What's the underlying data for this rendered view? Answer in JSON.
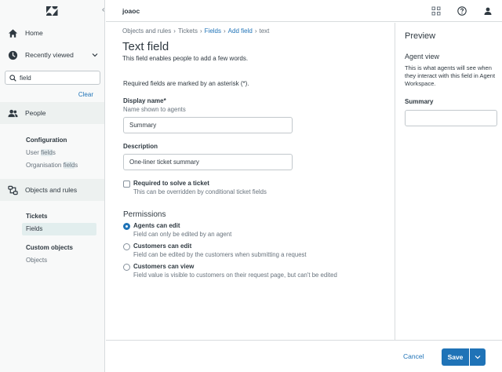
{
  "app": {
    "account": "joaoc"
  },
  "sidebar": {
    "home": "Home",
    "recently_viewed": "Recently viewed",
    "search_value": "field",
    "clear": "Clear",
    "people": "People",
    "configuration": "Configuration",
    "user_fields": {
      "pre": "User ",
      "hl": "field",
      "post": "s"
    },
    "org_fields": {
      "pre": "Organisation ",
      "hl": "field",
      "post": "s"
    },
    "objects_rules": "Objects and rules",
    "tickets": "Tickets",
    "fields": {
      "hl": "Field",
      "post": "s"
    },
    "custom_objects": "Custom objects",
    "objects": "Objects"
  },
  "breadcrumb": {
    "c1": "Objects and rules",
    "c2": "Tickets",
    "c3": "Fields",
    "c4": "Add field",
    "c5": "text",
    "sep": "›"
  },
  "page": {
    "title": "Text field",
    "subtitle": "This field enables people to add a few words.",
    "required_note": "Required fields are marked by an asterisk (*)."
  },
  "form": {
    "display_name_label": "Display name*",
    "display_name_hint": "Name shown to agents",
    "display_name_value": "Summary",
    "description_label": "Description",
    "description_value": "One-liner ticket summary",
    "required_label": "Required to solve a ticket",
    "required_hint": "This can be overridden by conditional ticket fields"
  },
  "permissions": {
    "heading": "Permissions",
    "options": [
      {
        "label": "Agents can edit",
        "hint": "Field can only be edited by an agent"
      },
      {
        "label": "Customers can edit",
        "hint": "Field can be edited by the customers when submitting a request"
      },
      {
        "label": "Customers can view",
        "hint": "Field value is visible to customers on their request page, but can't be edited"
      }
    ]
  },
  "preview": {
    "title": "Preview",
    "subtitle": "Agent view",
    "description": "This is what agents will see when they interact with this field in Agent Workspace.",
    "field_label": "Summary"
  },
  "footer": {
    "cancel": "Cancel",
    "save": "Save"
  },
  "colors": {
    "accent": "#1f73b7",
    "text": "#2f3941",
    "muted": "#68737d"
  }
}
